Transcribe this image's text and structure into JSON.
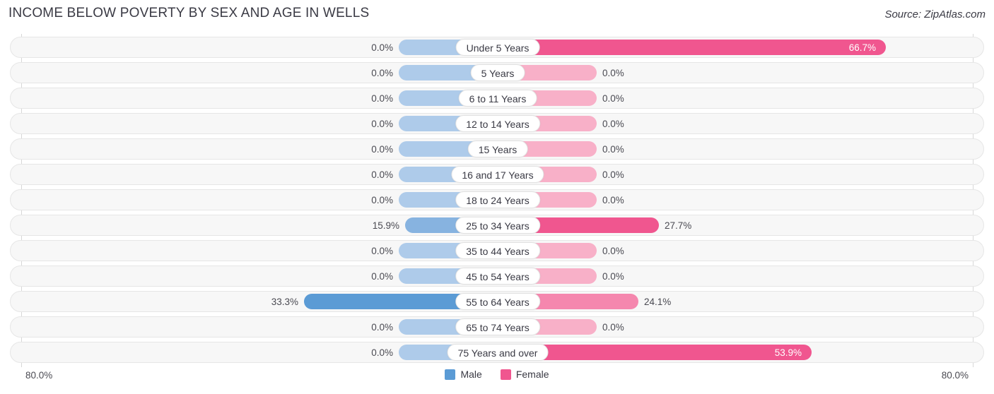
{
  "header": {
    "title": "INCOME BELOW POVERTY BY SEX AND AGE IN WELLS",
    "source": "Source: ZipAtlas.com"
  },
  "axis": {
    "left_label": "80.0%",
    "right_label": "80.0%",
    "max": 80.0
  },
  "legend": {
    "items": [
      {
        "label": "Male",
        "color": "#5b9bd5"
      },
      {
        "label": "Female",
        "color": "#f0568f"
      }
    ]
  },
  "colors": {
    "male_zero": "#aecbea",
    "male_low": "#87b3e0",
    "male_high": "#5b9bd5",
    "female_zero": "#f8b0c8",
    "female_low": "#f587ae",
    "female_high": "#f0568f",
    "row_background": "#f7f7f7",
    "row_border": "#e6e6e6",
    "text": "#4a4a52"
  },
  "chart_data": {
    "type": "bar",
    "title": "INCOME BELOW POVERTY BY SEX AND AGE IN WELLS",
    "xlabel": "",
    "ylabel": "",
    "orientation": "horizontal-diverging",
    "xlim": [
      80.0,
      80.0
    ],
    "grid": false,
    "legend_position": "bottom-center",
    "categories": [
      "Under 5 Years",
      "5 Years",
      "6 to 11 Years",
      "12 to 14 Years",
      "15 Years",
      "16 and 17 Years",
      "18 to 24 Years",
      "25 to 34 Years",
      "35 to 44 Years",
      "45 to 54 Years",
      "55 to 64 Years",
      "65 to 74 Years",
      "75 Years and over"
    ],
    "series": [
      {
        "name": "Male",
        "values": [
          0.0,
          0.0,
          0.0,
          0.0,
          0.0,
          0.0,
          0.0,
          15.9,
          0.0,
          0.0,
          33.3,
          0.0,
          0.0
        ],
        "labels": [
          "0.0%",
          "0.0%",
          "0.0%",
          "0.0%",
          "0.0%",
          "0.0%",
          "0.0%",
          "15.9%",
          "0.0%",
          "0.0%",
          "33.3%",
          "0.0%",
          "0.0%"
        ]
      },
      {
        "name": "Female",
        "values": [
          66.7,
          0.0,
          0.0,
          0.0,
          0.0,
          0.0,
          0.0,
          27.7,
          0.0,
          0.0,
          24.1,
          0.0,
          53.9
        ],
        "labels": [
          "66.7%",
          "0.0%",
          "0.0%",
          "0.0%",
          "0.0%",
          "0.0%",
          "0.0%",
          "27.7%",
          "0.0%",
          "0.0%",
          "24.1%",
          "0.0%",
          "53.9%"
        ]
      }
    ]
  }
}
